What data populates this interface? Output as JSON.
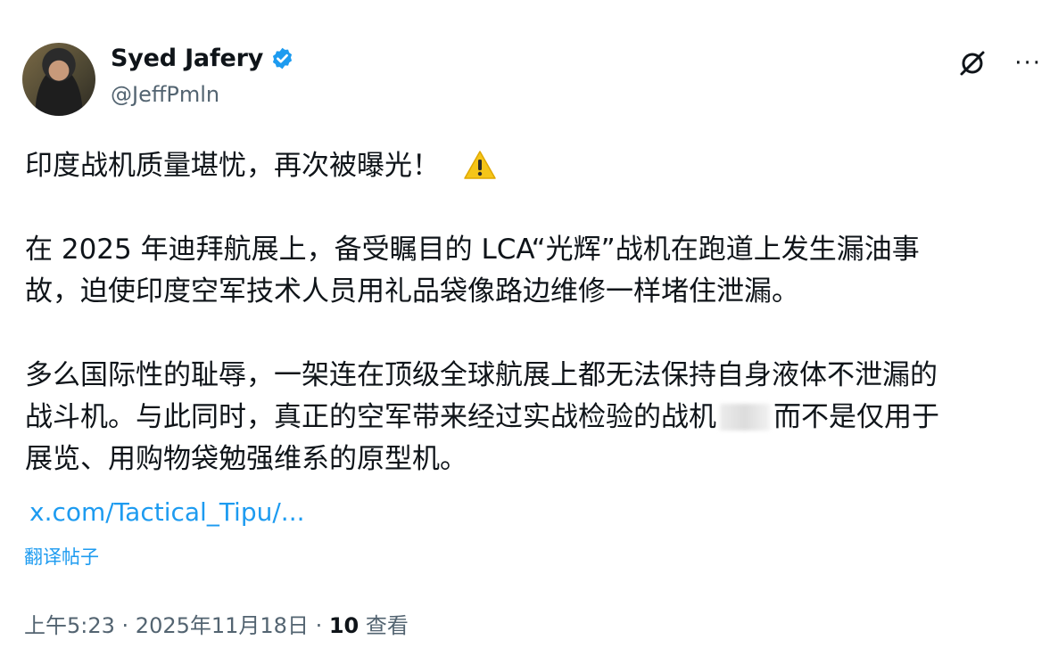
{
  "author": {
    "name": "Syed Jafery",
    "handle": "@JeffPmln"
  },
  "post": {
    "line1": "印度战机质量堪忧，再次被曝光！",
    "para2_line1": "在 2025 年迪拜航展上，备受瞩目的 LCA“光辉”战机在跑道上发生漏油事",
    "para2_line2": "故，迫使印度空军技术人员用礼品袋像路边维修一样堵住泄漏。",
    "para3_line1": "多么国际性的耻辱，一架连在顶级全球航展上都无法保持自身液体不泄漏的",
    "para3_line2a": "战斗机。与此同时，真正的空军带来经过实战检验的战机",
    "para3_line2b": "而不是仅用于",
    "para3_line3": "展览、用购物袋勉强维系的原型机。",
    "link": "x.com/Tactical_Tipu/...",
    "translate": "翻译帖子"
  },
  "meta": {
    "time": "上午5:23",
    "sep1": " · ",
    "date": "2025年11月18日",
    "sep2": " · ",
    "views_count": "10",
    "views_label": " 查看"
  },
  "colors": {
    "link": "#1d9bf0",
    "verified": "#1d9bf0",
    "warning": "#f5c518",
    "muted": "#536471"
  },
  "icons": [
    "verified-badge-icon",
    "grok-icon",
    "more-icon",
    "warning-icon"
  ]
}
